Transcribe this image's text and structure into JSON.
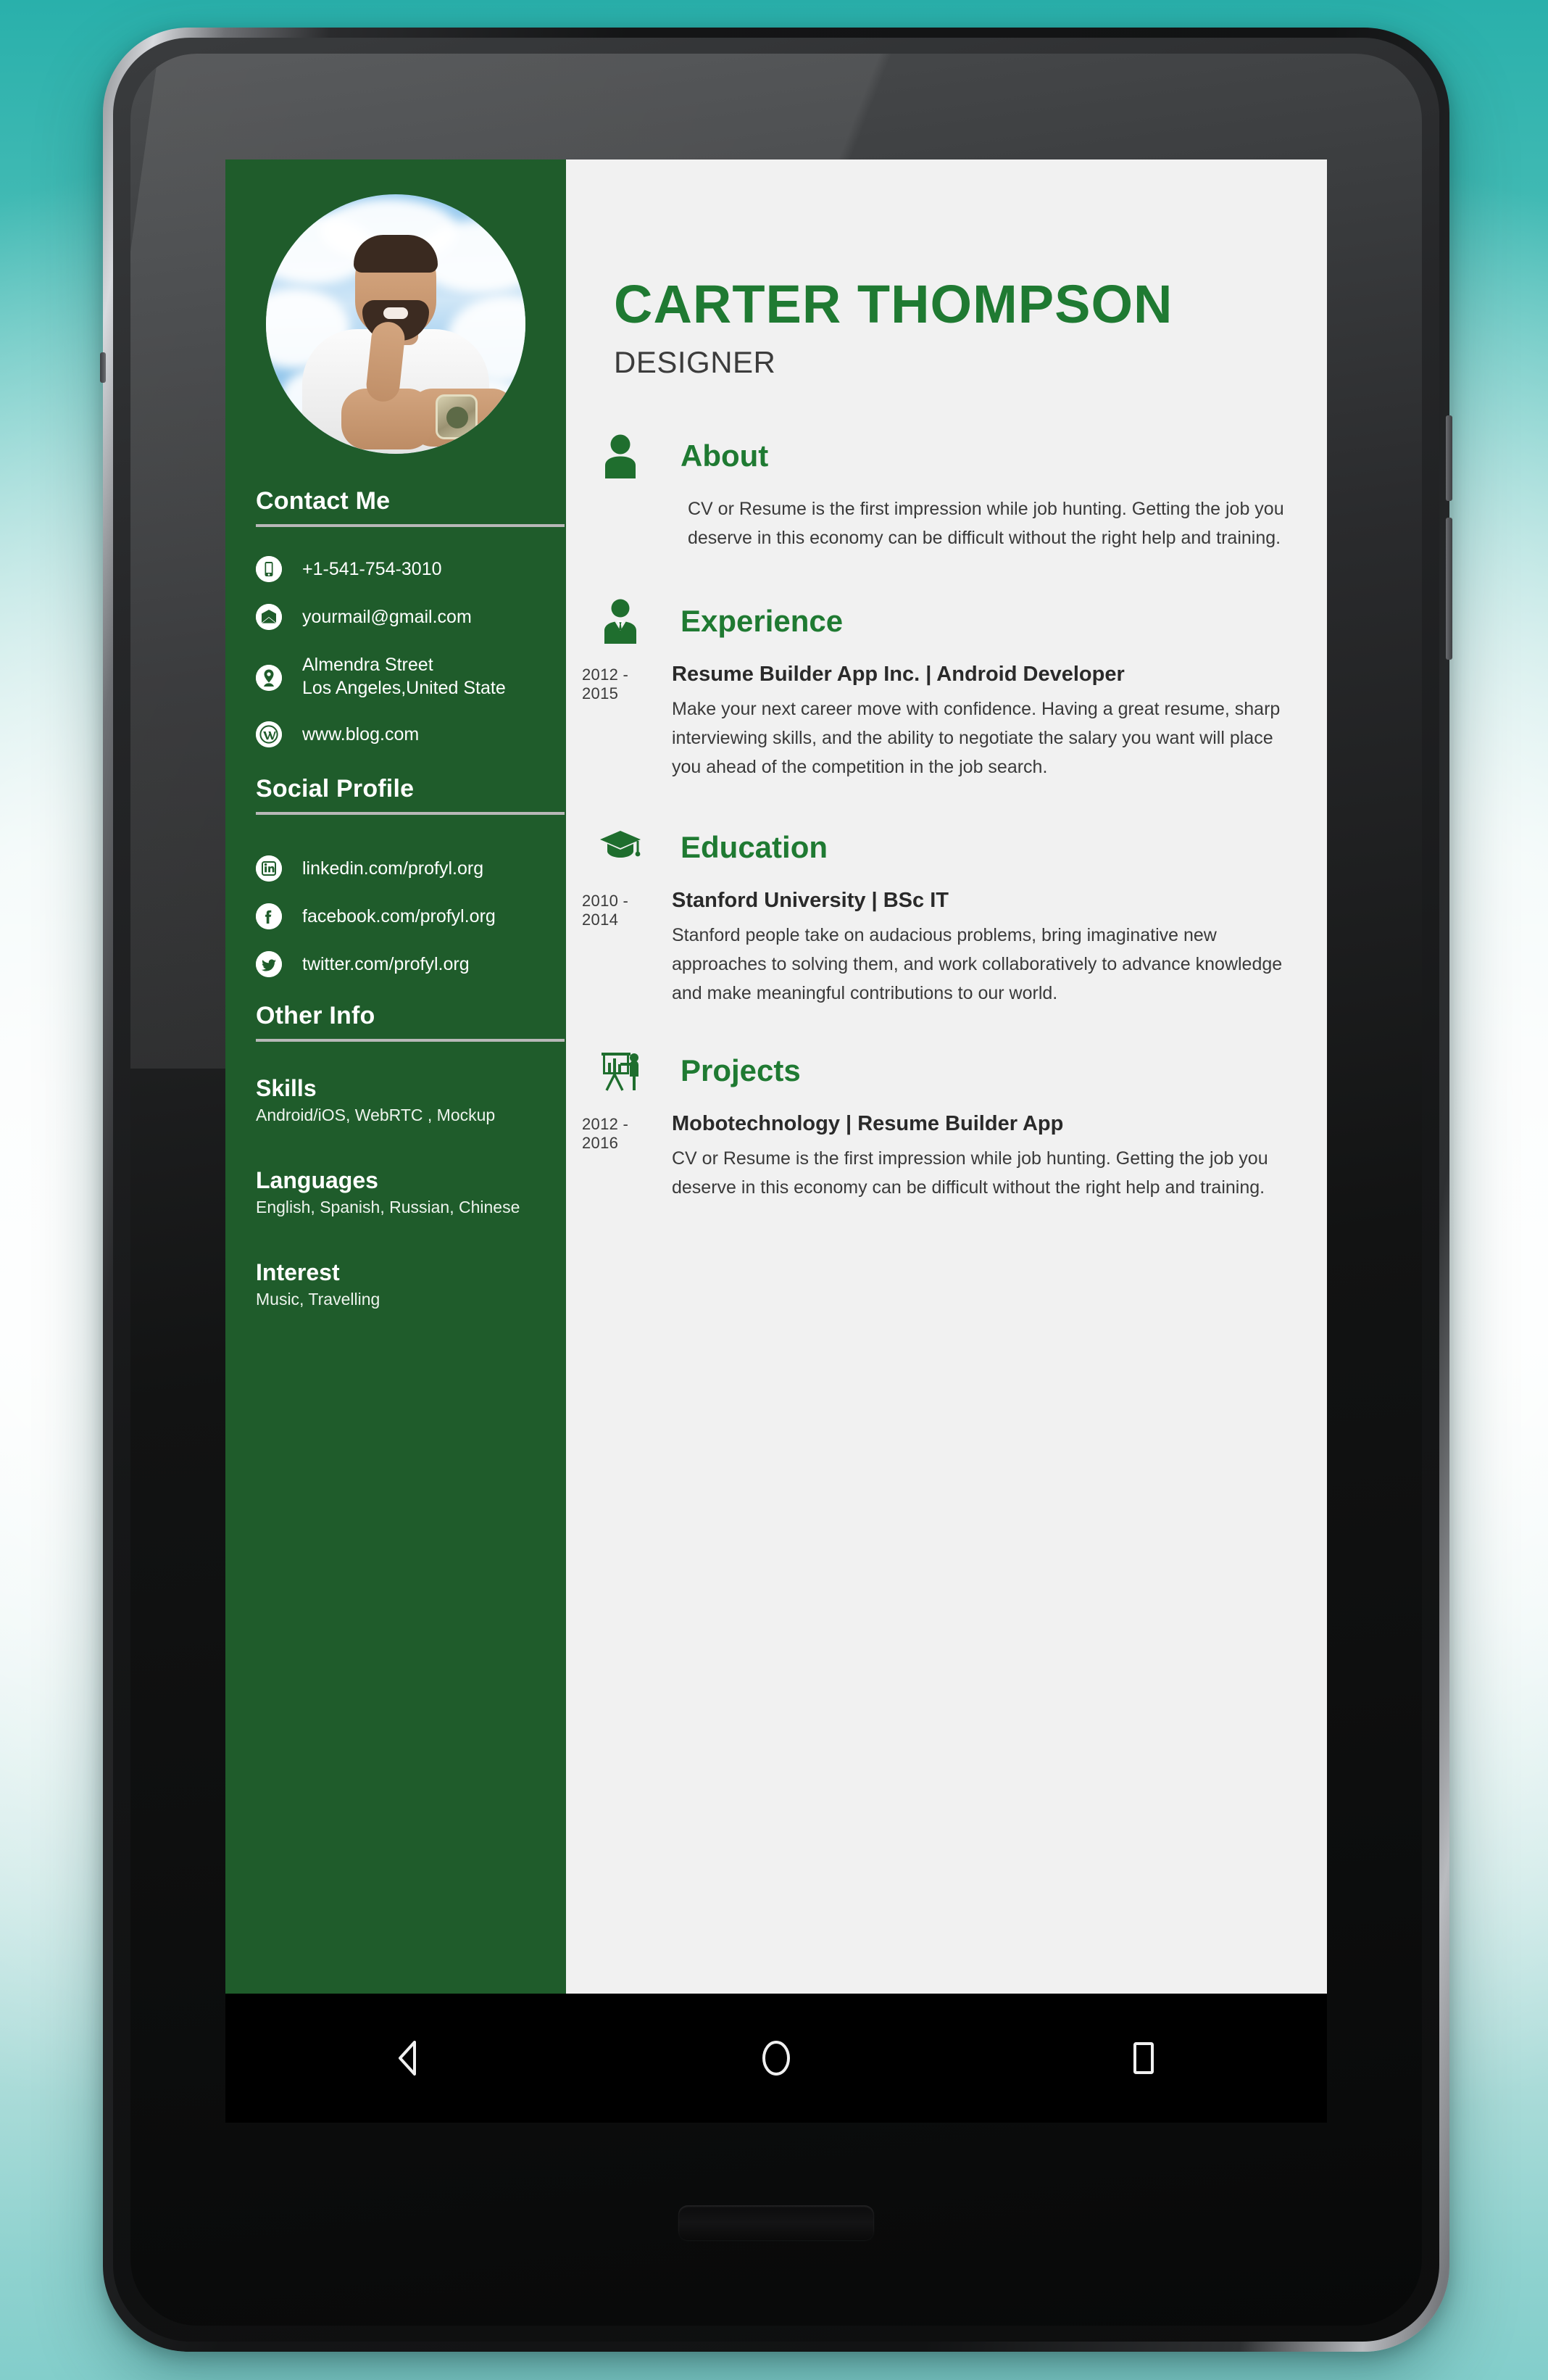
{
  "theme": {
    "sidebar_green": "#1f5c2b",
    "accent_green": "#1f7a32",
    "screen_bg": "#f1f1f1",
    "wallpaper_teal": "#29b0ab"
  },
  "profile": {
    "name": "CARTER THOMPSON",
    "role": "DESIGNER",
    "avatar_alt": "profile-photo"
  },
  "sidebar": {
    "contact": {
      "title": "Contact Me",
      "items": [
        {
          "icon": "phone-icon",
          "text": "+1-541-754-3010"
        },
        {
          "icon": "email-icon",
          "text": "yourmail@gmail.com"
        },
        {
          "icon": "location-icon",
          "text": "Almendra Street",
          "text2": "Los Angeles,United State"
        },
        {
          "icon": "wordpress-icon",
          "text": "www.blog.com"
        }
      ]
    },
    "social": {
      "title": "Social Profile",
      "items": [
        {
          "icon": "linkedin-icon",
          "text": "linkedin.com/profyl.org"
        },
        {
          "icon": "facebook-icon",
          "text": "facebook.com/profyl.org"
        },
        {
          "icon": "twitter-icon",
          "text": "twitter.com/profyl.org"
        }
      ]
    },
    "other_info": {
      "title": "Other Info",
      "blocks": [
        {
          "heading": "Skills",
          "text": "Android/iOS, WebRTC , Mockup"
        },
        {
          "heading": "Languages",
          "text": "English, Spanish, Russian, Chinese"
        },
        {
          "heading": "Interest",
          "text": "Music, Travelling"
        }
      ]
    }
  },
  "main": {
    "about": {
      "icon": "person-icon",
      "title": "About",
      "text": "CV or Resume is the first impression while job hunting. Getting the job you deserve in this economy can be difficult without the right help and training."
    },
    "experience": {
      "icon": "businessman-icon",
      "title": "Experience",
      "entries": [
        {
          "years": "2012 - 2015",
          "title": "Resume Builder App Inc. | Android Developer",
          "desc": "Make your next career move with confidence. Having a great resume, sharp interviewing skills, and the ability to negotiate the salary you want will place you ahead of the competition in the job search."
        }
      ]
    },
    "education": {
      "icon": "graduation-cap-icon",
      "title": "Education",
      "entries": [
        {
          "years": "2010 - 2014",
          "title": "Stanford University | BSc IT",
          "desc": "Stanford people take on audacious problems, bring imaginative new approaches to solving them, and work collaboratively to advance knowledge and make meaningful contributions to our world."
        }
      ]
    },
    "projects": {
      "icon": "presentation-icon",
      "title": "Projects",
      "entries": [
        {
          "years": "2012 - 2016",
          "title": "Mobotechnology | Resume Builder App",
          "desc": "CV or Resume is the first impression while job hunting. Getting the job you deserve in this economy can be difficult without the right help and training."
        }
      ]
    }
  },
  "navbar": {
    "back": "back-button",
    "home": "home-button",
    "recents": "recents-button"
  }
}
